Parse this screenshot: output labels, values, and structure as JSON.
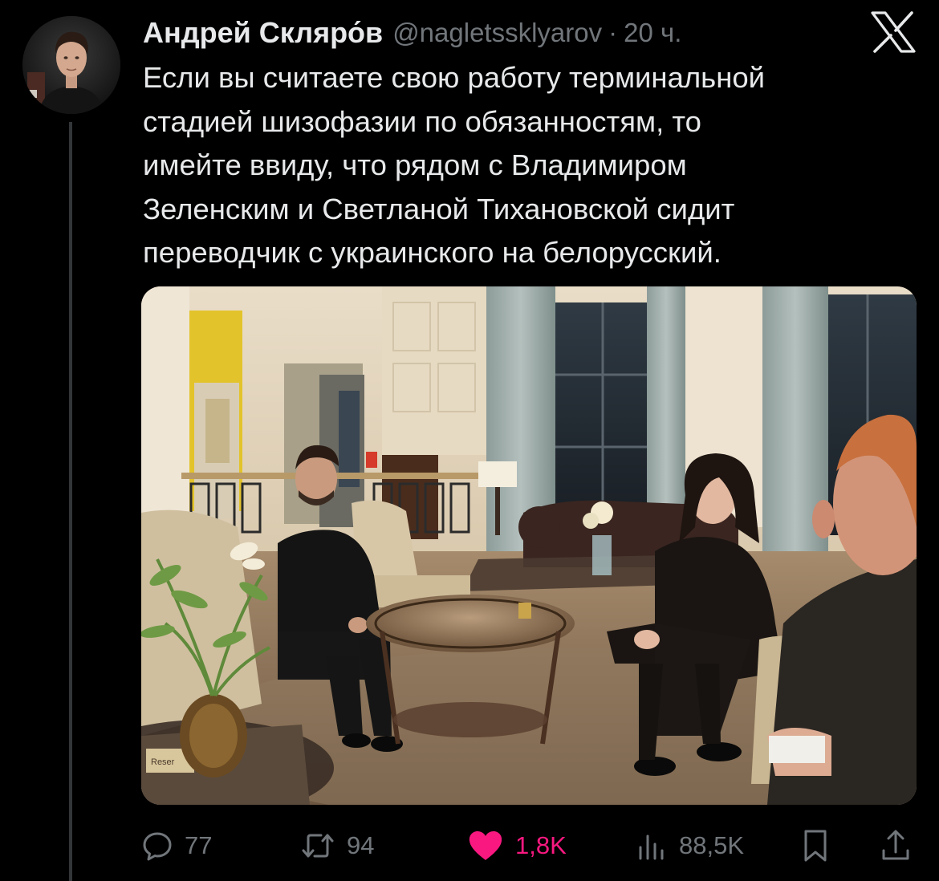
{
  "post": {
    "author": {
      "display_name": "Андрей Скляро́в",
      "handle": "@nagletssklyarov",
      "separator": "·",
      "time_ago": "20 ч."
    },
    "platform_logo": "x-logo-icon",
    "text_lines": [
      "Если вы считаете свою работу терминальной",
      "стадией шизофазии по обязанностям, то",
      "имейте ввиду, что рядом с Владимиром",
      "Зеленским и Светланой Тихановской сидит",
      "переводчик с украинского на белорусский."
    ],
    "media": {
      "icon": "photo",
      "table_card_text": "Reser"
    }
  },
  "actions": {
    "replies": {
      "icon": "reply-icon",
      "count": "77"
    },
    "reposts": {
      "icon": "repost-icon",
      "count": "94"
    },
    "likes": {
      "icon": "heart-icon",
      "count": "1,8K",
      "liked": true
    },
    "views": {
      "icon": "views-icon",
      "count": "88,5K"
    },
    "bookmark": {
      "icon": "bookmark-icon"
    },
    "share": {
      "icon": "share-icon"
    }
  },
  "colors": {
    "background": "#000000",
    "text_primary": "#e7e9ea",
    "text_secondary": "#71767b",
    "like_active": "#f91880",
    "thread_line": "#333639"
  }
}
